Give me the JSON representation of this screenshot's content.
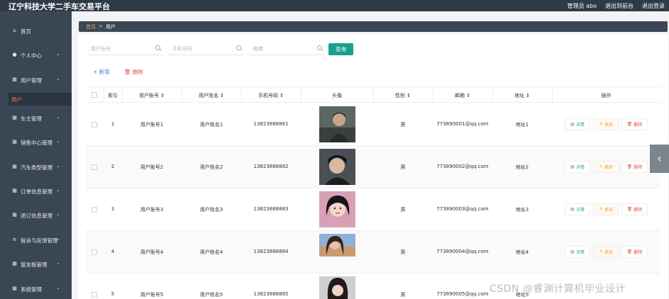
{
  "app": {
    "title": "辽宁科技大学二手车交易平台",
    "admin_label": "管理员 abo",
    "back_label": "退出到前台",
    "logout_label": "退出登录"
  },
  "sidebar": {
    "items": [
      {
        "label": "首页",
        "icon": "home-icon",
        "has_chevron": false
      },
      {
        "label": "个人中心",
        "icon": "user-icon",
        "has_chevron": true
      },
      {
        "label": "用户管理",
        "icon": "grid-icon",
        "has_chevron": true
      },
      {
        "label": "车主管理",
        "icon": "grid-icon",
        "has_chevron": true
      },
      {
        "label": "销售中心管理",
        "icon": "grid-icon",
        "has_chevron": true
      },
      {
        "label": "汽车类型管理",
        "icon": "grid-icon",
        "has_chevron": true
      },
      {
        "label": "订单信息管理",
        "icon": "grid-icon",
        "has_chevron": true
      },
      {
        "label": "退订信息管理",
        "icon": "grid-icon",
        "has_chevron": true
      },
      {
        "label": "投诉与反馈管理",
        "icon": "sliders-icon",
        "has_chevron": true
      },
      {
        "label": "留言板管理",
        "icon": "grid-icon",
        "has_chevron": true
      },
      {
        "label": "系统管理",
        "icon": "grid-icon",
        "has_chevron": true
      }
    ],
    "active_sub": "用户"
  },
  "breadcrumb": {
    "home": "首页",
    "sep": ">",
    "current": "用户"
  },
  "search": {
    "account_placeholder": "用户账号",
    "phone_placeholder": "手机号码",
    "email_placeholder": "邮箱",
    "query_label": "查询"
  },
  "actions": {
    "add_label": "+ 新增",
    "delete_label": "删除"
  },
  "table": {
    "columns": [
      "索引",
      "用户账号",
      "用户姓名",
      "手机号码",
      "头像",
      "性别",
      "邮箱",
      "地址",
      "操作"
    ],
    "sortable": [
      "用户账号",
      "用户姓名",
      "手机号码",
      "性别",
      "邮箱",
      "地址"
    ],
    "rows": [
      {
        "index": "1",
        "account": "用户账号1",
        "name": "用户姓名1",
        "phone": "13823888881",
        "gender": "男",
        "email": "773890001@qq.com",
        "address": "地址1"
      },
      {
        "index": "2",
        "account": "用户账号2",
        "name": "用户姓名2",
        "phone": "13823888882",
        "gender": "男",
        "email": "773890002@qq.com",
        "address": "地址2"
      },
      {
        "index": "3",
        "account": "用户账号3",
        "name": "用户姓名3",
        "phone": "13823888883",
        "gender": "男",
        "email": "773890003@qq.com",
        "address": "地址3"
      },
      {
        "index": "4",
        "account": "用户账号4",
        "name": "用户姓名4",
        "phone": "13823888884",
        "gender": "男",
        "email": "773890004@qq.com",
        "address": "地址4"
      },
      {
        "index": "5",
        "account": "用户账号5",
        "name": "用户姓名5",
        "phone": "13823888885",
        "gender": "男",
        "email": "773890005@qq.com",
        "address": "地址5"
      }
    ],
    "row_buttons": {
      "detail": "详情",
      "edit": "修改",
      "delete": "删除"
    }
  },
  "watermark": "CSDN @睿渊计算机毕业设计",
  "colors": {
    "topbar": "#2e3a46",
    "sidebar": "#3a4653",
    "accent": "#18a08b",
    "active": "#f07a4a"
  }
}
